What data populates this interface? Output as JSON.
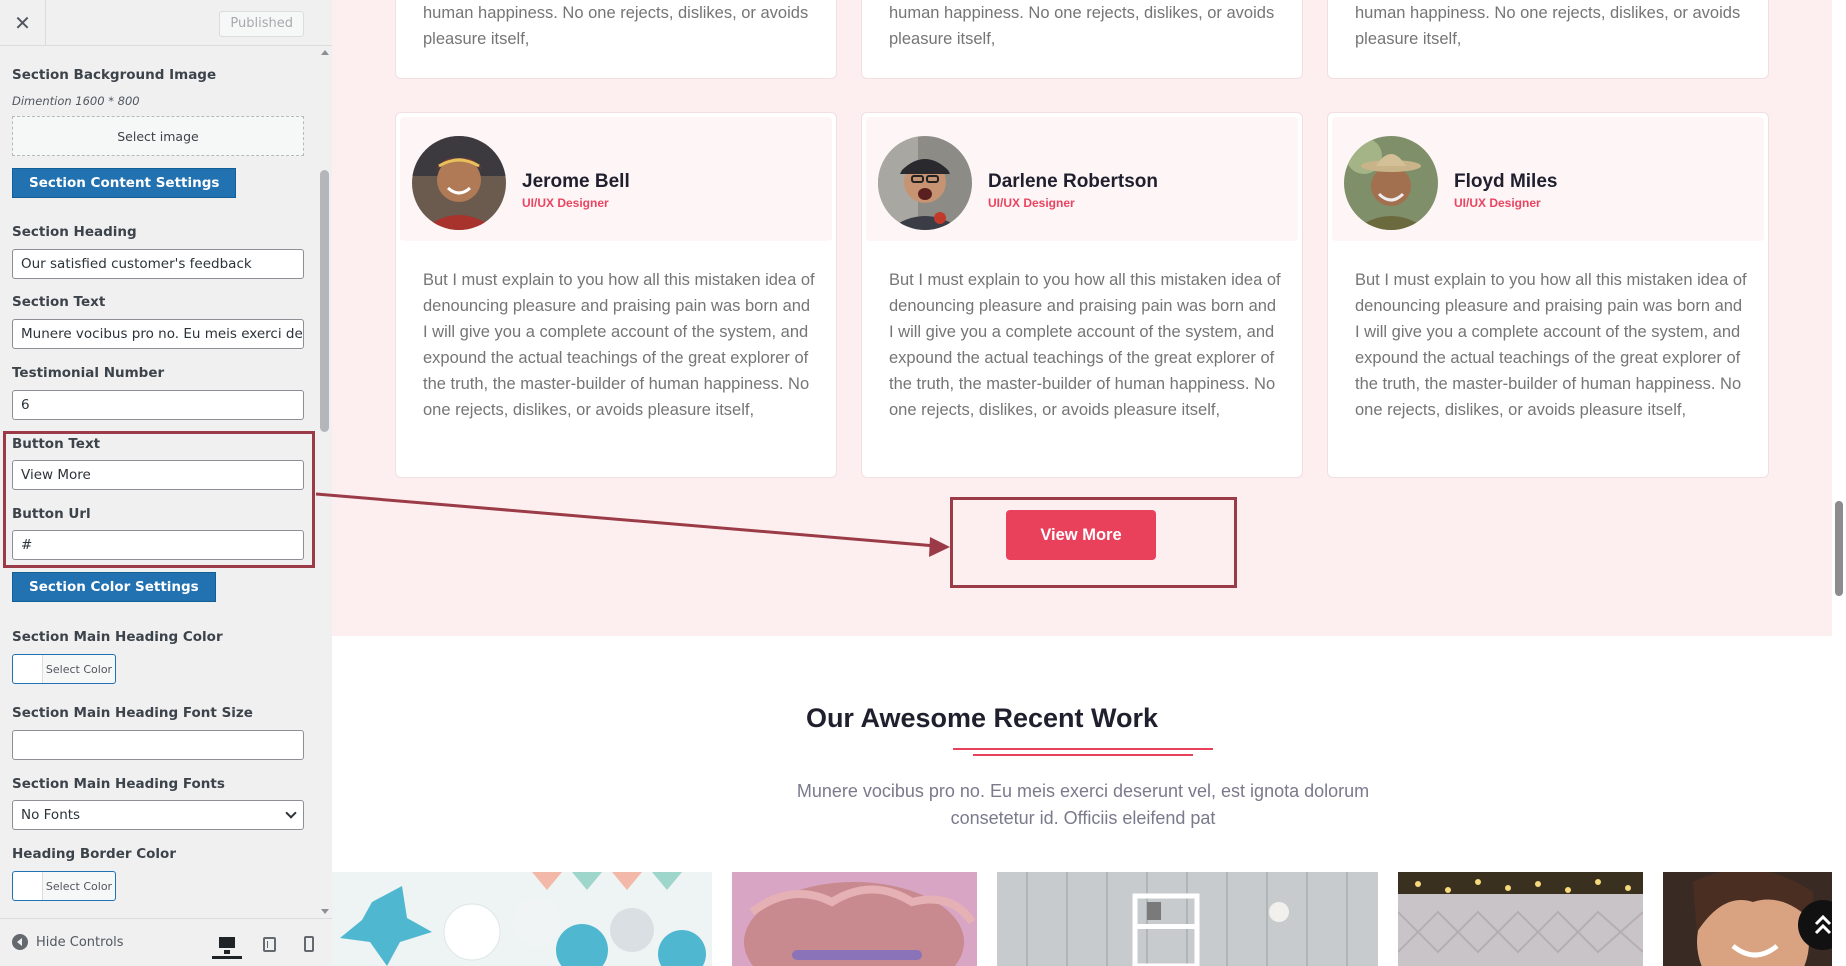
{
  "panel": {
    "close_label": "✕",
    "published_label": "Published",
    "controls": {
      "bg_image_label": "Section Background Image",
      "bg_image_desc": "Dimention 1600 * 800",
      "select_image_label": "Select image",
      "content_settings_label": "Section Content Settings",
      "heading_label": "Section Heading",
      "heading_value": "Our satisfied customer's feedback",
      "text_label": "Section Text",
      "text_value": "Munere vocibus pro no. Eu meis exerci deserunt vel",
      "testimonial_number_label": "Testimonial Number",
      "testimonial_number_value": "6",
      "button_text_label": "Button Text",
      "button_text_value": "View More",
      "button_url_label": "Button Url",
      "button_url_value": "#",
      "color_settings_label": "Section Color Settings",
      "main_heading_color_label": "Section Main Heading Color",
      "select_color_label": "Select Color",
      "main_heading_font_size_label": "Section Main Heading Font Size",
      "main_heading_font_size_value": "",
      "main_heading_fonts_label": "Section Main Heading Fonts",
      "main_heading_fonts_value": "No Fonts",
      "heading_border_color_label": "Heading Border Color",
      "heading_border_select_color_label": "Select Color"
    },
    "footer": {
      "hide_controls_label": "Hide Controls",
      "devices": [
        "desktop-icon",
        "tablet-icon",
        "mobile-icon"
      ]
    }
  },
  "preview": {
    "top_cards": [
      {
        "text": "human happiness. No one rejects, dislikes, or avoids pleasure itself,"
      },
      {
        "text": "human happiness. No one rejects, dislikes, or avoids pleasure itself,"
      },
      {
        "text": "human happiness. No one rejects, dislikes, or avoids pleasure itself,"
      }
    ],
    "testimonials": [
      {
        "name": "Jerome Bell",
        "role": "UI/UX Designer",
        "text": "But I must explain to you how all this mistaken idea of denouncing pleasure and praising pain was born and I will give you a complete account of the system, and expound the actual teachings of the great explorer of the truth, the master-builder of human happiness. No one rejects, dislikes, or avoids pleasure itself,"
      },
      {
        "name": "Darlene Robertson",
        "role": "UI/UX Designer",
        "text": "But I must explain to you how all this mistaken idea of denouncing pleasure and praising pain was born and I will give you a complete account of the system, and expound the actual teachings of the great explorer of the truth, the master-builder of human happiness. No one rejects, dislikes, or avoids pleasure itself,"
      },
      {
        "name": "Floyd Miles",
        "role": "UI/UX Designer",
        "text": "But I must explain to you how all this mistaken idea of denouncing pleasure and praising pain was born and I will give you a complete account of the system, and expound the actual teachings of the great explorer of the truth, the master-builder of human happiness. No one rejects, dislikes, or avoids pleasure itself,"
      }
    ],
    "view_more_label": "View More",
    "work_heading": "Our Awesome Recent Work",
    "work_text": "Munere vocibus pro no. Eu meis exerci deserunt vel, est ignota dolorum consetetur id. Officiis eleifend pat"
  },
  "colors": {
    "accent": "#e9405c",
    "wp_blue": "#2271b1",
    "highlight": "#9b3b47",
    "pink_bg": "#fdeef0"
  }
}
